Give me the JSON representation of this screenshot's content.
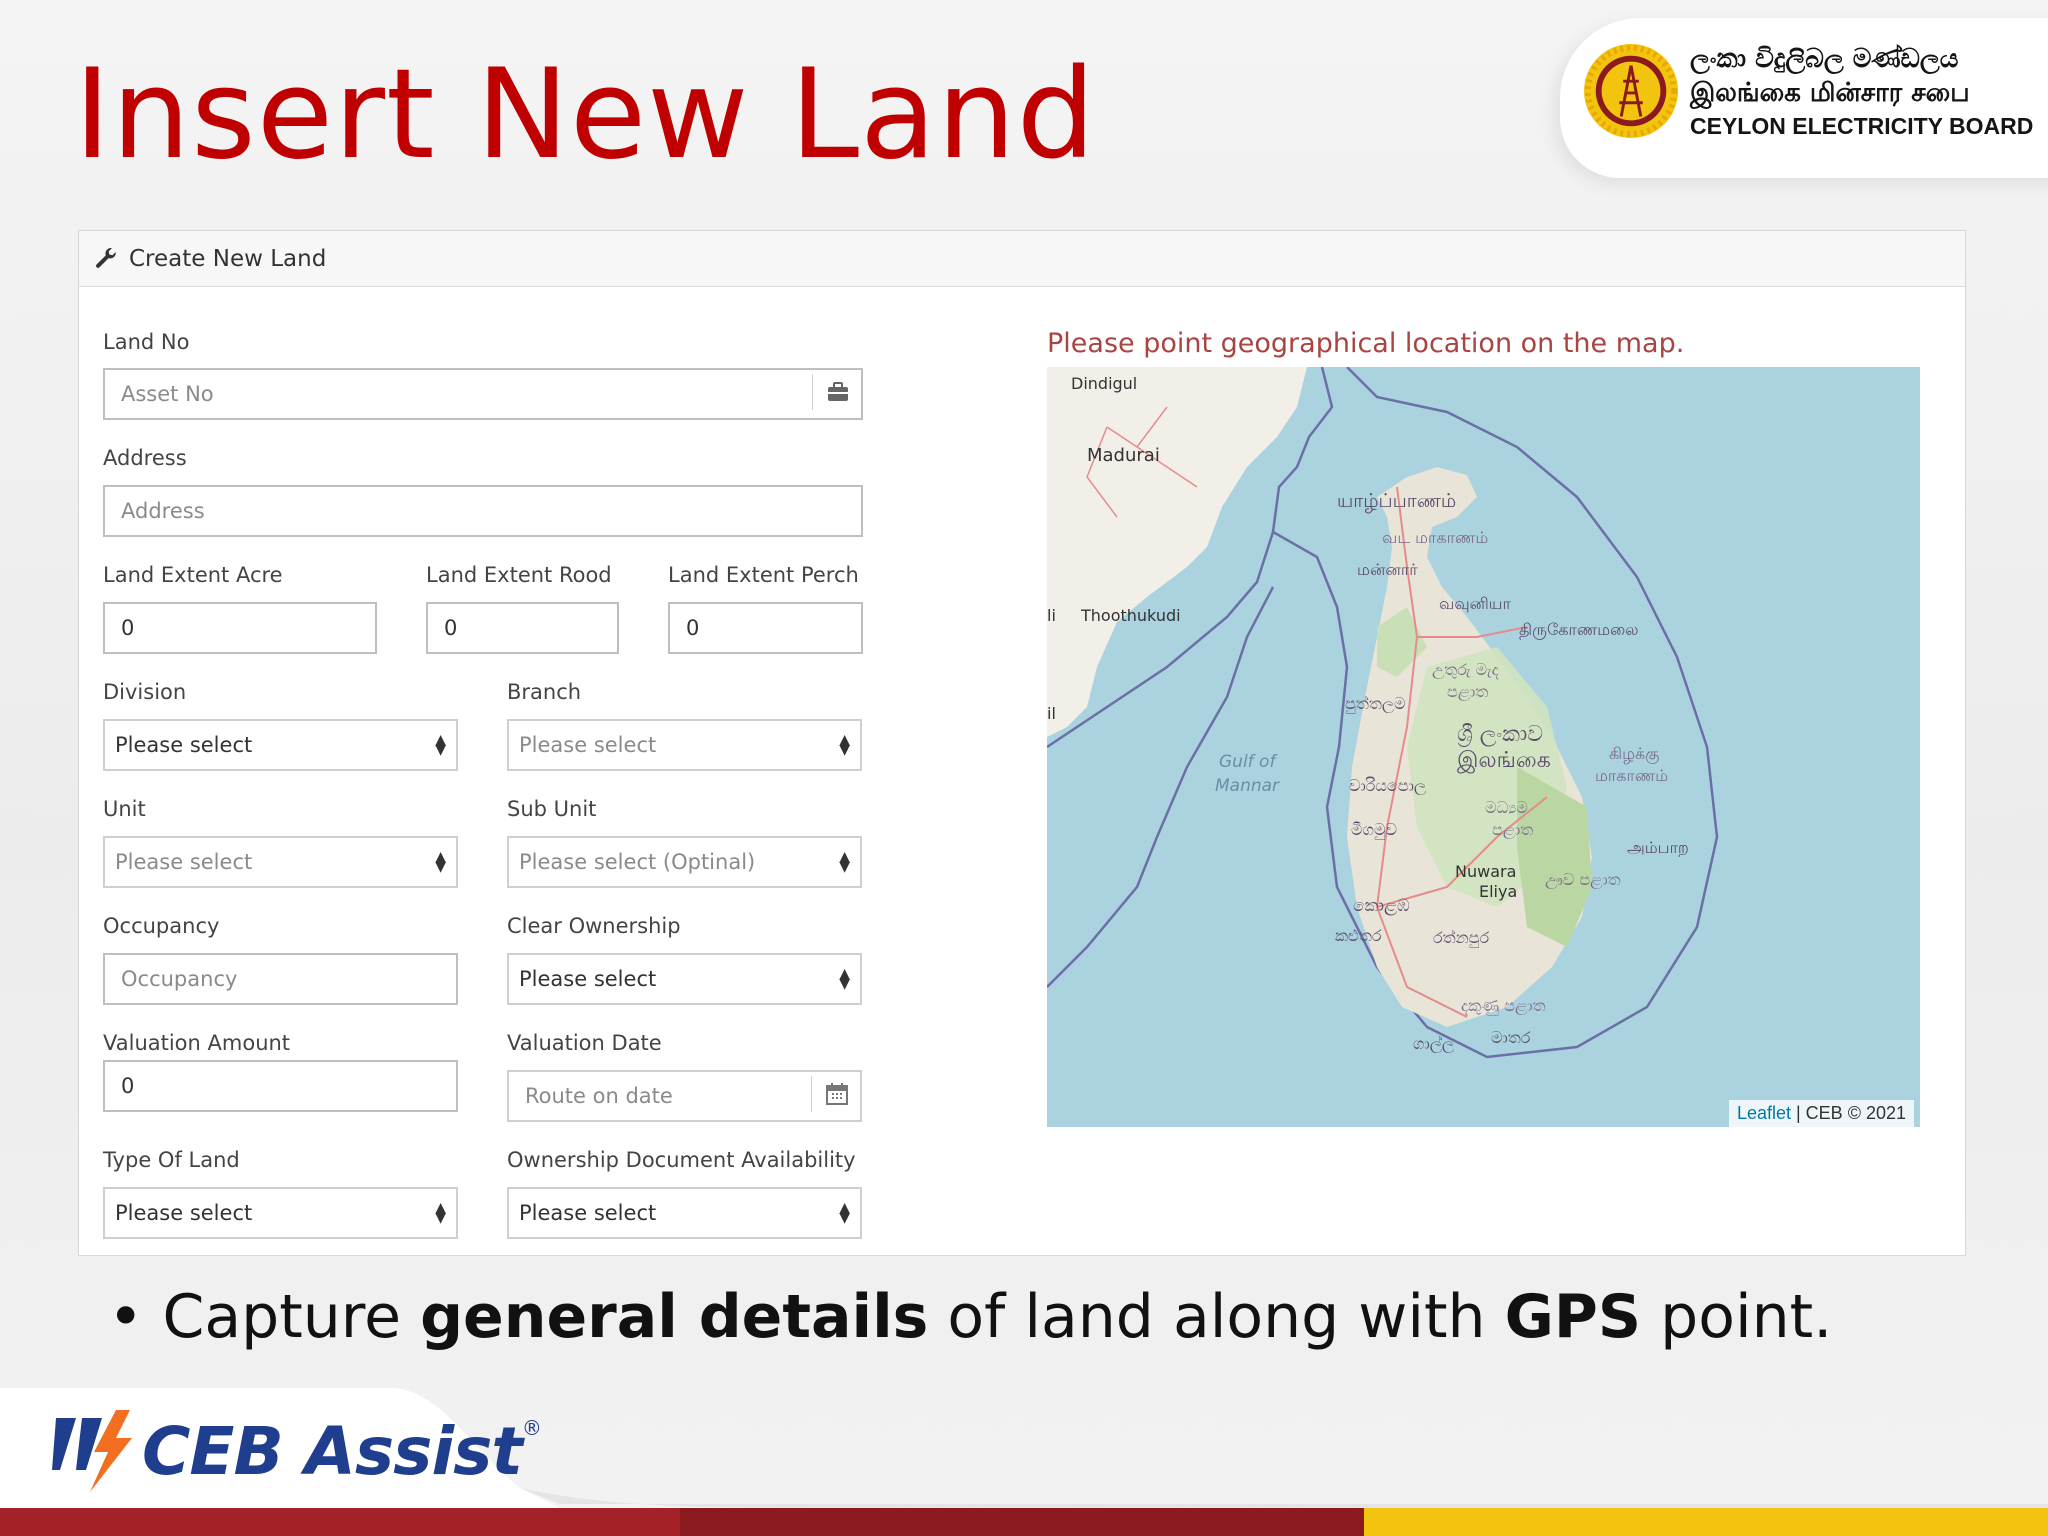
{
  "slide": {
    "title": "Insert New Land",
    "bullet": {
      "prefix": "Capture ",
      "bold1": "general details",
      "middle": " of land along with ",
      "bold2": "GPS",
      "suffix": " point."
    }
  },
  "org": {
    "line_sinhala": "ලංකා විදුලිබල මණ්ඩලය",
    "line_tamil": "இலங்கை மின்சார சபை",
    "line_english": "CEYLON ELECTRICITY BOARD"
  },
  "brand": {
    "name": "CEB Assist",
    "registered": "®"
  },
  "panel": {
    "heading": "Create New Land"
  },
  "form": {
    "land_no": {
      "label": "Land No",
      "placeholder": "Asset No"
    },
    "address": {
      "label": "Address",
      "placeholder": "Address"
    },
    "extent_acre": {
      "label": "Land Extent Acre",
      "value": "0"
    },
    "extent_rood": {
      "label": "Land Extent Rood",
      "value": "0"
    },
    "extent_perch": {
      "label": "Land Extent Perch",
      "value": "0"
    },
    "division": {
      "label": "Division",
      "value": "Please select"
    },
    "branch": {
      "label": "Branch",
      "value": "Please select"
    },
    "unit": {
      "label": "Unit",
      "value": "Please select"
    },
    "sub_unit": {
      "label": "Sub Unit",
      "value": "Please select (Optinal)"
    },
    "occupancy": {
      "label": "Occupancy",
      "placeholder": "Occupancy"
    },
    "clear_ownership": {
      "label": "Clear Ownership",
      "value": "Please select"
    },
    "valuation_amount": {
      "label": "Valuation Amount",
      "value": "0"
    },
    "valuation_date": {
      "label": "Valuation Date",
      "placeholder": "Route on date"
    },
    "type_of_land": {
      "label": "Type Of Land",
      "value": "Please select"
    },
    "ownership_doc": {
      "label": "Ownership Document Availability",
      "value": "Please select"
    }
  },
  "map": {
    "message": "Please point geographical location on the map.",
    "attribution_link": "Leaflet",
    "attribution_rest": " | CEB © 2021",
    "labels": {
      "dindigul": "Dindigul",
      "madurai": "Madurai",
      "thoothukudi": "Thoothukudi",
      "li": "li",
      "il": "il",
      "gulf1": "Gulf of",
      "gulf2": "Mannar",
      "jaffna": "யாழ்ப்பாணம்",
      "northern": "வட மாகாணம்",
      "mannar": "மன்னார்",
      "vavuniya": "வவுனியா",
      "trinco": "திருகோணமலை",
      "ncp1": "උතුරු මැද",
      "ncp2": "පළාත",
      "puttalam": "පුත්තලම",
      "sl1": "ශ්‍රී ලංකාව",
      "sl2": "இலங்கை",
      "eastern1": "கிழக்கு",
      "eastern2": "மாகாணம்",
      "kuru": "වාරියපොල",
      "central1": "මධ්‍යම",
      "central2": "පළාත",
      "negombo": "මීගමුව",
      "ampara": "அம்பாற",
      "nuwara1": "Nuwara",
      "nuwara2": "Eliya",
      "uva": "ඌව පළාත",
      "colombo": "කොළඹ",
      "kalutara": "කළුතර",
      "ratnapura": "රත්නපුර",
      "southern": "දකුණු පළාත",
      "galle": "ගාල්ල",
      "matara": "මාතර"
    }
  },
  "colors": {
    "title": "#c00000",
    "brand_blue": "#1f3f8e",
    "brand_orange": "#f26f21",
    "bar_red": "#a32127",
    "bar_darkred": "#8b1a1e",
    "bar_yellow": "#f2c40f"
  }
}
